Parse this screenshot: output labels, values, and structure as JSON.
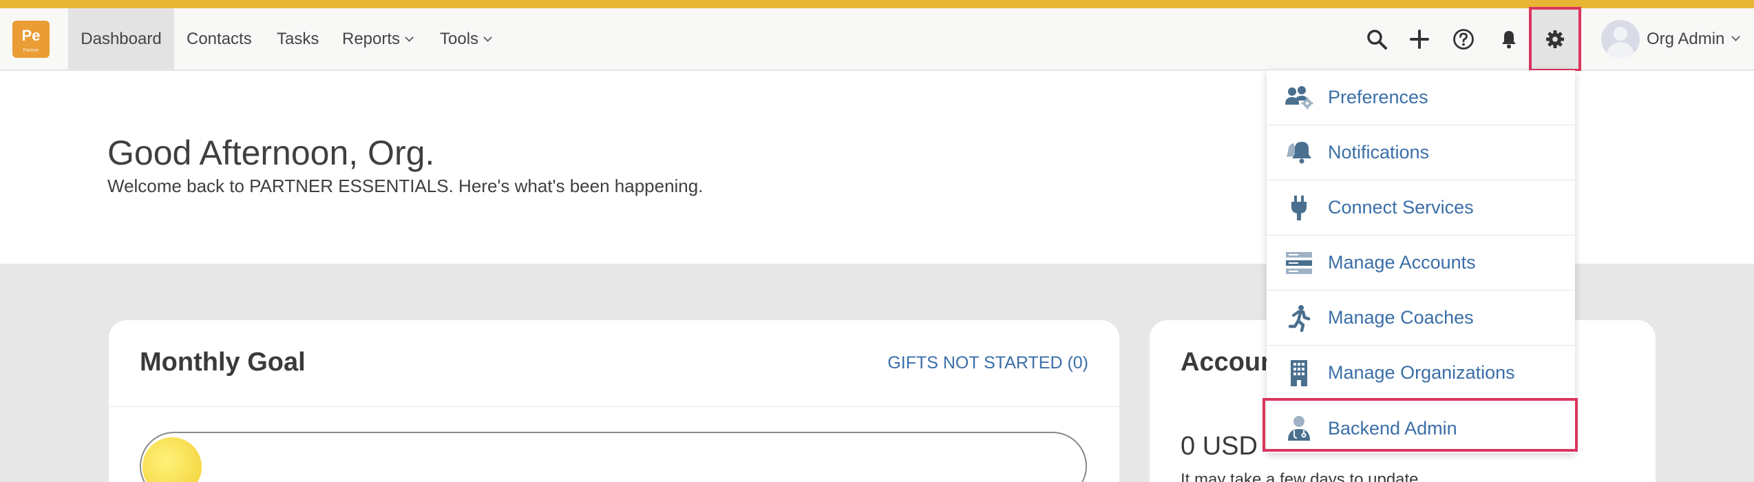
{
  "logo": {
    "text": "Pe",
    "subtext": "Partner"
  },
  "nav": {
    "items": [
      {
        "label": "Dashboard"
      },
      {
        "label": "Contacts"
      },
      {
        "label": "Tasks"
      },
      {
        "label": "Reports"
      },
      {
        "label": "Tools"
      }
    ]
  },
  "toolbar": {
    "icons": [
      "search-icon",
      "plus-icon",
      "help-icon",
      "bell-icon",
      "gear-icon"
    ]
  },
  "user": {
    "name": "Org Admin"
  },
  "welcome": {
    "greeting": "Good Afternoon, Org.",
    "subtext": "Welcome back to PARTNER ESSENTIALS. Here's what's been happening."
  },
  "cards": {
    "monthly_goal": {
      "title": "Monthly Goal",
      "link": "GIFTS NOT STARTED (0)"
    },
    "account": {
      "title": "Accounts",
      "amount": "0 USD",
      "note": "It may take a few days to update"
    }
  },
  "settings_menu": {
    "items": [
      {
        "label": "Preferences",
        "icon": "users-gear-icon"
      },
      {
        "label": "Notifications",
        "icon": "bells-icon"
      },
      {
        "label": "Connect Services",
        "icon": "plug-icon"
      },
      {
        "label": "Manage Accounts",
        "icon": "server-icon"
      },
      {
        "label": "Manage Coaches",
        "icon": "running-person-icon"
      },
      {
        "label": "Manage Organizations",
        "icon": "building-icon"
      },
      {
        "label": "Backend Admin",
        "icon": "user-doctor-icon"
      }
    ],
    "highlighted": "Backend Admin"
  },
  "colors": {
    "accent": "#e8b534",
    "logo": "#e99d34",
    "link": "#3a6ea8",
    "highlight": "#d9365e",
    "icon": "#4a6f8f"
  }
}
